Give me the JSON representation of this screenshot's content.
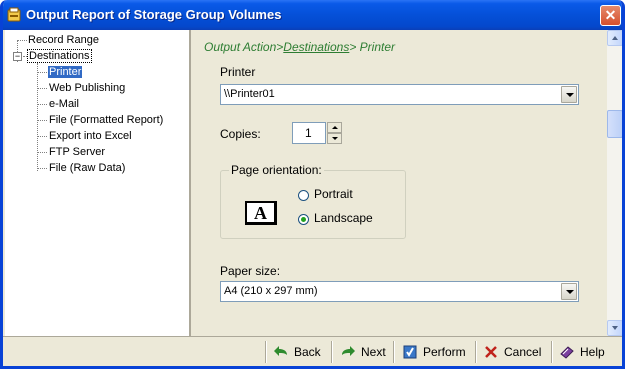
{
  "window": {
    "title": "Output Report of Storage Group Volumes",
    "close_glyph": "✕"
  },
  "tree": {
    "items": [
      {
        "label": "Record Range"
      },
      {
        "label": "Destinations"
      },
      {
        "label": "Printer"
      },
      {
        "label": "Web Publishing"
      },
      {
        "label": "e-Mail"
      },
      {
        "label": "File (Formatted Report)"
      },
      {
        "label": "Export into Excel"
      },
      {
        "label": "FTP Server"
      },
      {
        "label": "File (Raw Data)"
      }
    ],
    "expander_glyph": "−"
  },
  "breadcrumb": {
    "part1": "Output Action>",
    "part2": "Destinations",
    "part3": "> Printer"
  },
  "printer": {
    "label": "Printer",
    "value": "\\\\Printer01"
  },
  "copies": {
    "label": "Copies:",
    "value": "1"
  },
  "orientation": {
    "legend": "Page orientation:",
    "icon_letter": "A",
    "options": [
      {
        "label": "Portrait",
        "checked": false
      },
      {
        "label": "Landscape",
        "checked": true
      }
    ]
  },
  "paper": {
    "label": "Paper size:",
    "value": "A4 (210 x 297 mm)"
  },
  "toolbar": {
    "back": "Back",
    "next": "Next",
    "perform": "Perform",
    "cancel": "Cancel",
    "help": "Help"
  },
  "colors": {
    "titlebar": "#0550d8",
    "breadcrumb": "#2d7d32",
    "selection": "#316ac5",
    "face": "#ece9d8"
  }
}
